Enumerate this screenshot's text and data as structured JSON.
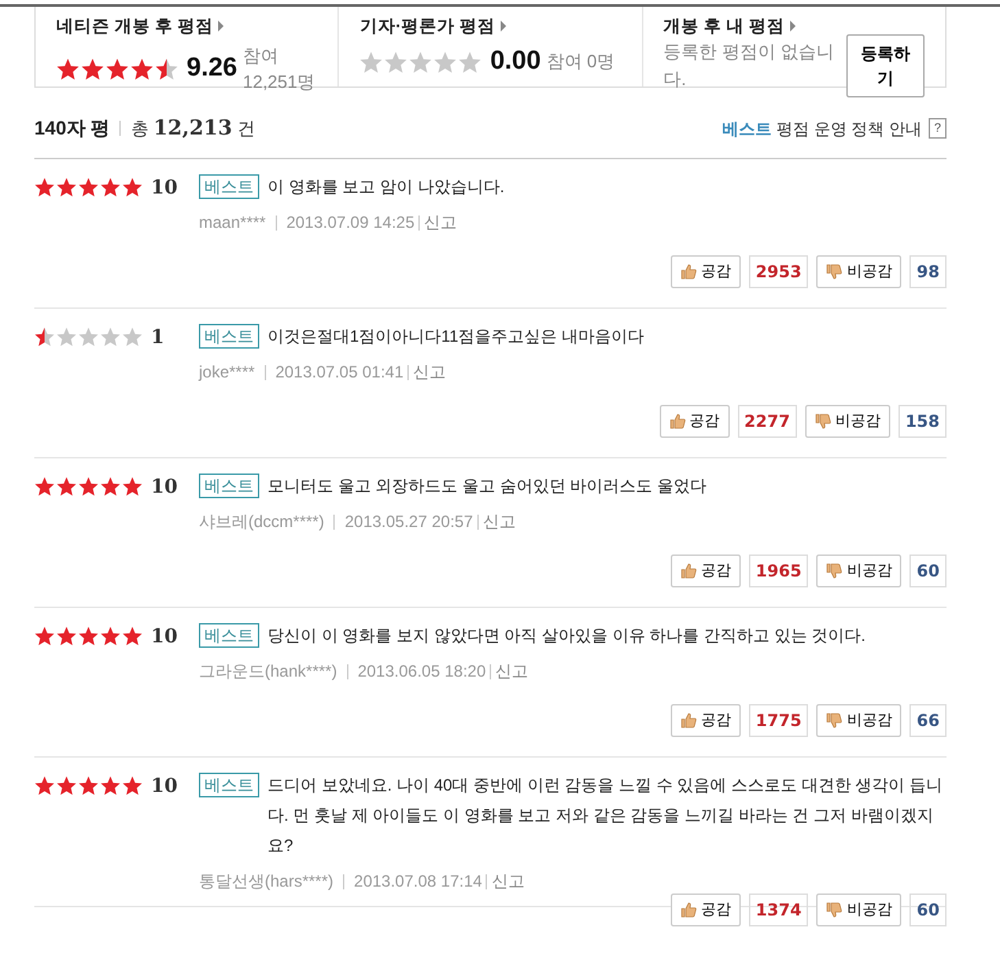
{
  "summary": [
    {
      "title": "네티즌 개봉 후 평점",
      "kind": "score",
      "stars": 4.5,
      "score": "9.26",
      "count": "참여 12,251명"
    },
    {
      "title": "기자·평론가 평점",
      "kind": "score",
      "stars": 0,
      "score": "0.00",
      "count": "참여 0명"
    },
    {
      "title": "개봉 후 내 평점",
      "kind": "mine",
      "message": "등록한 평점이 없습니다.",
      "button": "등록하기"
    }
  ],
  "header": {
    "title": "140자 평",
    "total_prefix": "총",
    "total": "12,213",
    "total_suffix": "건",
    "policy_best": "베스트",
    "policy_rest": "평점 운영 정책 안내",
    "help": "?"
  },
  "reviews": [
    {
      "stars": 5,
      "score": "10",
      "badge": "베스트",
      "text": "이 영화를 보고 암이 나았습니다.",
      "author": "maan****",
      "date": "2013.07.09 14:25",
      "report": "신고",
      "like": "공감",
      "likes": "2953",
      "dislike": "비공감",
      "dislikes": "98"
    },
    {
      "stars": 0.5,
      "score": "1",
      "badge": "베스트",
      "text": "이것은절대1점이아니다11점을주고싶은 내마음이다",
      "author": "joke****",
      "date": "2013.07.05 01:41",
      "report": "신고",
      "like": "공감",
      "likes": "2277",
      "dislike": "비공감",
      "dislikes": "158"
    },
    {
      "stars": 5,
      "score": "10",
      "badge": "베스트",
      "text": "모니터도 울고 외장하드도 울고 숨어있던 바이러스도 울었다",
      "author": "샤브레(dccm****)",
      "date": "2013.05.27 20:57",
      "report": "신고",
      "like": "공감",
      "likes": "1965",
      "dislike": "비공감",
      "dislikes": "60"
    },
    {
      "stars": 5,
      "score": "10",
      "badge": "베스트",
      "text": "당신이 이 영화를 보지 않았다면 아직 살아있을 이유 하나를 간직하고 있는 것이다.",
      "author": "그라운드(hank****)",
      "date": "2013.06.05 18:20",
      "report": "신고",
      "like": "공감",
      "likes": "1775",
      "dislike": "비공감",
      "dislikes": "66"
    },
    {
      "stars": 5,
      "score": "10",
      "badge": "베스트",
      "text": "드디어 보았네요. 나이 40대 중반에 이런 감동을 느낄 수 있음에 스스로도 대견한 생각이 듭니다. 먼 훗날 제 아이들도 이 영화를 보고 저와 같은 감동을 느끼길 바라는 건 그저 바램이겠지요?",
      "author": "통달선생(hars****)",
      "date": "2013.07.08 17:14",
      "report": "신고",
      "like": "공감",
      "likes": "1374",
      "dislike": "비공감",
      "dislikes": "60"
    }
  ]
}
